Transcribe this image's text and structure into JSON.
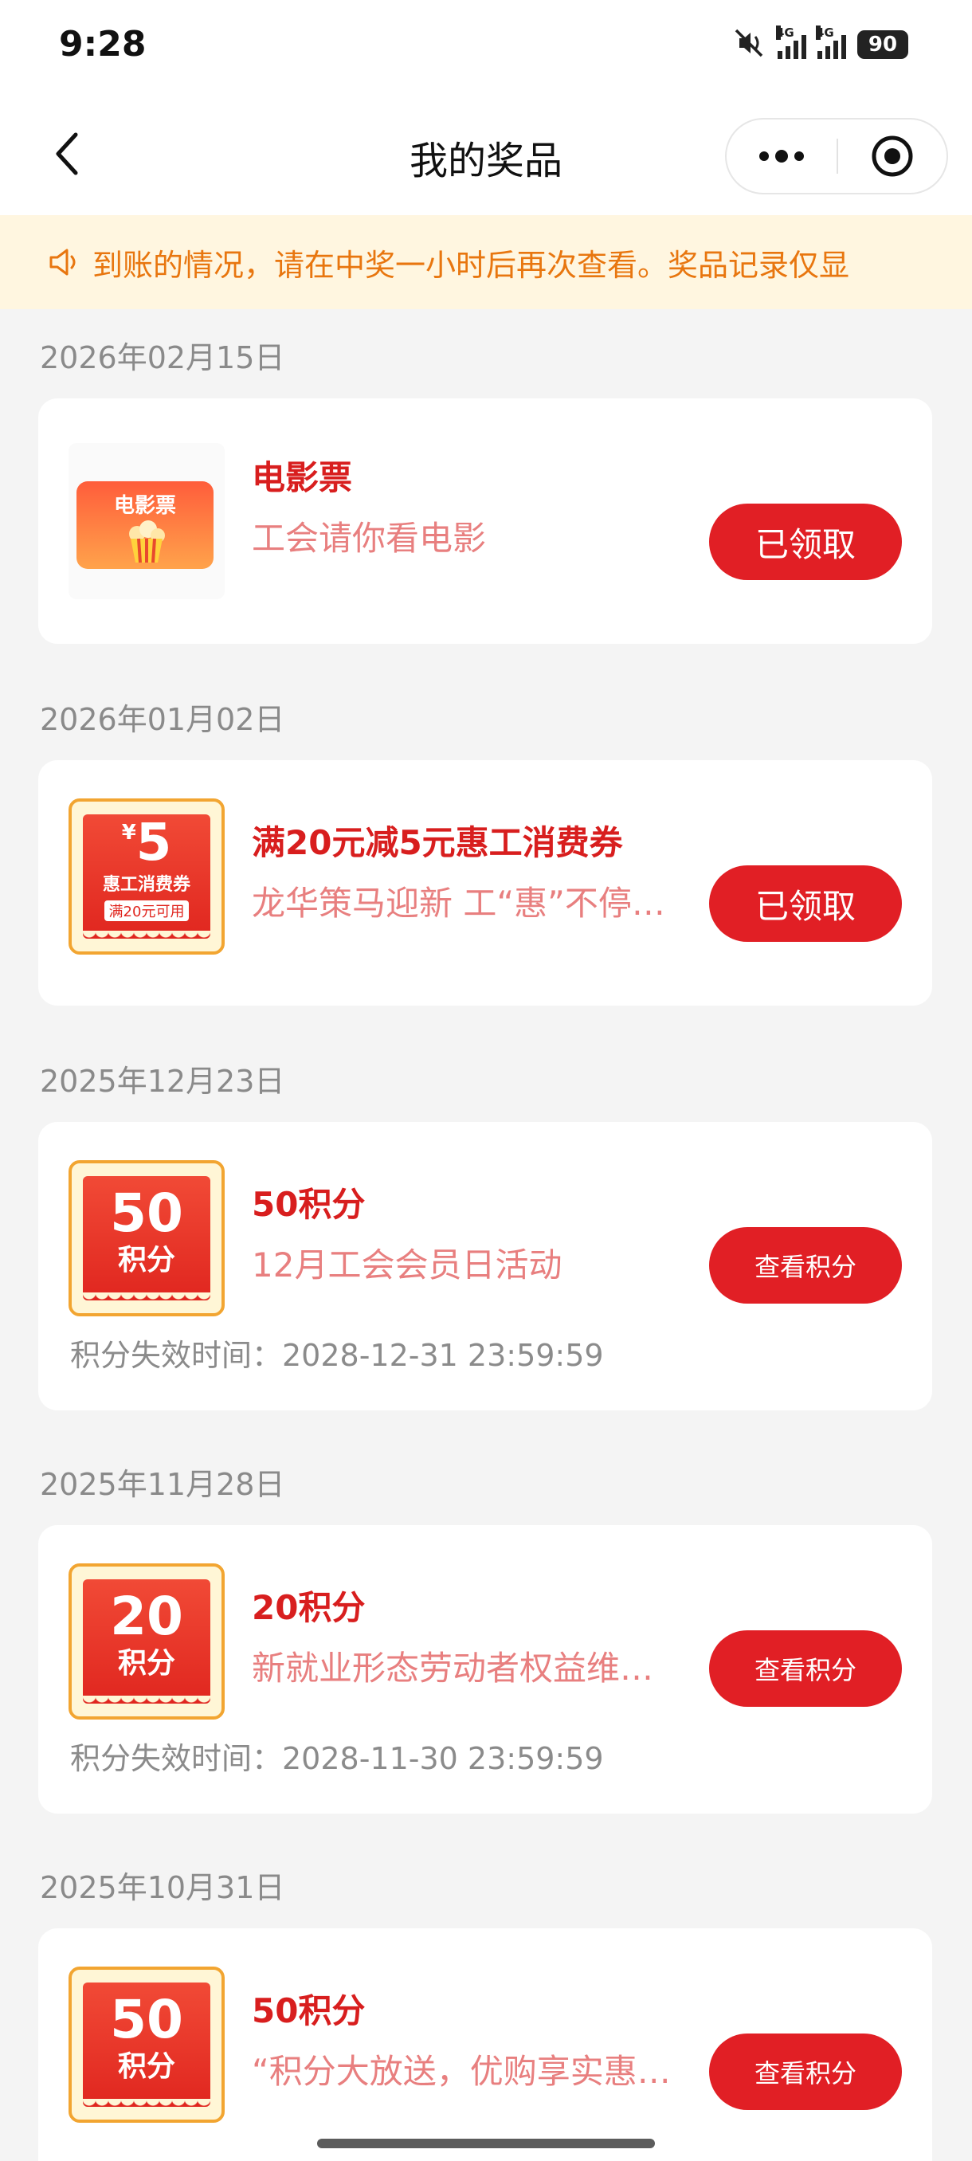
{
  "status_bar": {
    "time": "9:28",
    "net_1": "4G",
    "net_2": "4G",
    "battery": "90"
  },
  "nav": {
    "title": "我的奖品"
  },
  "notice": {
    "text": "到账的情况，请在中奖一小时后再次查看。奖品记录仅显"
  },
  "colors": {
    "accent_red": "#e11f25",
    "title_red": "#d81e1e",
    "desc_pink": "#e87f7f",
    "notice_orange": "#e8760f",
    "notice_bg": "#fff6e0",
    "badge_gold": "#f2a531"
  },
  "prizes": [
    {
      "date": "2026年02月15日",
      "thumb": "movie-ticket",
      "thumb_text": "电影票",
      "name": "电影票",
      "desc": "工会请你看电影",
      "button": "已领取"
    },
    {
      "date": "2026年01月02日",
      "thumb": "voucher",
      "thumb_currency": "¥",
      "thumb_value": "5",
      "thumb_type": "惠工消费券",
      "thumb_condition": "满20元可用",
      "name": "满20元减5元惠工消费券",
      "desc": "龙华策马迎新 工“惠”不停…",
      "button": "已领取"
    },
    {
      "date": "2025年12月23日",
      "thumb": "points",
      "thumb_value": "50",
      "thumb_unit": "积分",
      "name": "50积分",
      "desc": "12月工会会员日活动",
      "button": "查看积分",
      "expiry": "积分失效时间：2028-12-31 23:59:59"
    },
    {
      "date": "2025年11月28日",
      "thumb": "points",
      "thumb_value": "20",
      "thumb_unit": "积分",
      "name": "20积分",
      "desc": "新就业形态劳动者权益维…",
      "button": "查看积分",
      "expiry": "积分失效时间：2028-11-30 23:59:59"
    },
    {
      "date": "2025年10月31日",
      "thumb": "points",
      "thumb_value": "50",
      "thumb_unit": "积分",
      "name": "50积分",
      "desc": "“积分大放送，优购享实惠…",
      "button": "查看积分"
    }
  ]
}
